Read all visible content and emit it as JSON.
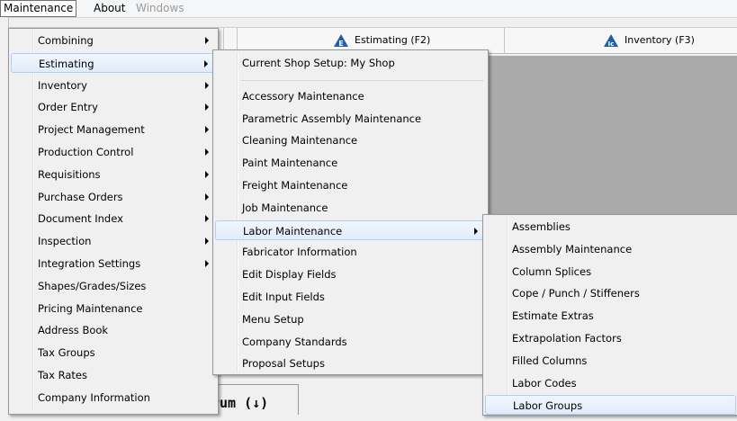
{
  "menubar": {
    "items": [
      {
        "label": "Maintenance"
      },
      {
        "label": "About"
      },
      {
        "label": "Windows"
      }
    ]
  },
  "toolbar": {
    "estimating_label": "Estimating (F2)",
    "inventory_label": "Inventory (F3)",
    "estimating_icon": "estimating-icon",
    "inventory_icon": "inventory-icon",
    "estimating_icon_letter": "E",
    "inventory_icon_letter": "Ic"
  },
  "background_text": "rum (↓)",
  "menu1": {
    "items": [
      {
        "label": "Combining",
        "sub": true
      },
      {
        "label": "Estimating",
        "sub": true
      },
      {
        "label": "Inventory",
        "sub": true
      },
      {
        "label": "Order Entry",
        "sub": true
      },
      {
        "label": "Project Management",
        "sub": true
      },
      {
        "label": "Production Control",
        "sub": true
      },
      {
        "label": "Requisitions",
        "sub": true
      },
      {
        "label": "Purchase Orders",
        "sub": true
      },
      {
        "label": "Document Index",
        "sub": true
      },
      {
        "label": "Inspection",
        "sub": true
      },
      {
        "label": "Integration Settings",
        "sub": true
      },
      {
        "label": "Shapes/Grades/Sizes",
        "sub": false
      },
      {
        "label": "Pricing Maintenance",
        "sub": false
      },
      {
        "label": "Address Book",
        "sub": false
      },
      {
        "label": "Tax Groups",
        "sub": false
      },
      {
        "label": "Tax Rates",
        "sub": false
      },
      {
        "label": "Company Information",
        "sub": false
      }
    ]
  },
  "menu2": {
    "items": [
      {
        "label": "Current Shop Setup: My Shop",
        "sub": false
      },
      {
        "label": "Accessory Maintenance",
        "sub": false
      },
      {
        "label": "Parametric Assembly Maintenance",
        "sub": false
      },
      {
        "label": "Cleaning Maintenance",
        "sub": false
      },
      {
        "label": "Paint Maintenance",
        "sub": false
      },
      {
        "label": "Freight Maintenance",
        "sub": false
      },
      {
        "label": "Job Maintenance",
        "sub": false
      },
      {
        "label": "Labor Maintenance",
        "sub": true
      },
      {
        "label": "Fabricator Information",
        "sub": false
      },
      {
        "label": "Edit Display Fields",
        "sub": false
      },
      {
        "label": "Edit Input Fields",
        "sub": false
      },
      {
        "label": "Menu Setup",
        "sub": false
      },
      {
        "label": "Company Standards",
        "sub": false
      },
      {
        "label": "Proposal Setups",
        "sub": false
      }
    ]
  },
  "menu3": {
    "items": [
      {
        "label": "Assemblies"
      },
      {
        "label": "Assembly Maintenance"
      },
      {
        "label": "Column Splices"
      },
      {
        "label": "Cope / Punch / Stiffeners"
      },
      {
        "label": "Estimate Extras"
      },
      {
        "label": "Extrapolation Factors"
      },
      {
        "label": "Filled Columns"
      },
      {
        "label": "Labor Codes"
      },
      {
        "label": "Labor Groups"
      }
    ]
  }
}
